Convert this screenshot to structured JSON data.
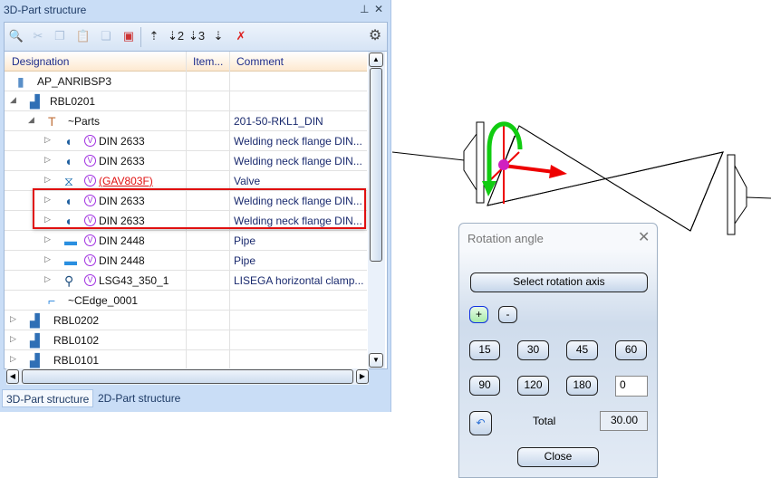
{
  "panel": {
    "title": "3D-Part structure",
    "pin_icon": "pin-icon",
    "close_icon": "close-icon",
    "columns": [
      "Designation",
      "Item...",
      "Comment"
    ],
    "rows": [
      {
        "level": 0,
        "expander": "",
        "icon": "project-icon",
        "variant": false,
        "name": "AP_ANRIBSP3",
        "comment": ""
      },
      {
        "level": 1,
        "expander": "expanded",
        "icon": "plant-icon",
        "variant": false,
        "name": "RBL0201",
        "comment": ""
      },
      {
        "level": 2,
        "expander": "expanded",
        "icon": "parts-icon",
        "variant": false,
        "name": "~Parts",
        "comment": "201-50-RKL1_DIN"
      },
      {
        "level": 3,
        "expander": "collapsed",
        "icon": "flange-icon",
        "variant": true,
        "name": "DIN 2633",
        "comment": "Welding neck flange DIN..."
      },
      {
        "level": 3,
        "expander": "collapsed",
        "icon": "flange-icon",
        "variant": true,
        "name": "DIN 2633",
        "comment": "Welding neck flange DIN..."
      },
      {
        "level": 3,
        "expander": "collapsed",
        "icon": "valve-icon",
        "variant": true,
        "name": "(GAV803F)",
        "comment": "Valve",
        "error": true
      },
      {
        "level": 3,
        "expander": "collapsed",
        "icon": "flange-icon",
        "variant": true,
        "name": "DIN 2633",
        "comment": "Welding neck flange DIN..."
      },
      {
        "level": 3,
        "expander": "collapsed",
        "icon": "flange-icon",
        "variant": true,
        "name": "DIN 2633",
        "comment": "Welding neck flange DIN..."
      },
      {
        "level": 3,
        "expander": "collapsed",
        "icon": "pipe-icon",
        "variant": true,
        "name": "DIN 2448",
        "comment": "Pipe"
      },
      {
        "level": 3,
        "expander": "collapsed",
        "icon": "pipe-icon",
        "variant": true,
        "name": "DIN 2448",
        "comment": "Pipe"
      },
      {
        "level": 3,
        "expander": "collapsed",
        "icon": "clamp-icon",
        "variant": true,
        "name": "LSG43_350_1",
        "comment": "LISEGA horizontal clamp..."
      },
      {
        "level": 2,
        "expander": "",
        "icon": "edge-icon",
        "variant": false,
        "name": "~CEdge_0001",
        "comment": ""
      },
      {
        "level": 0,
        "expander": "collapsed",
        "icon": "plant-icon",
        "variant": false,
        "name": "RBL0202",
        "comment": ""
      },
      {
        "level": 0,
        "expander": "collapsed",
        "icon": "plant-icon",
        "variant": false,
        "name": "RBL0102",
        "comment": ""
      },
      {
        "level": 0,
        "expander": "collapsed",
        "icon": "plant-icon",
        "variant": false,
        "name": "RBL0101",
        "comment": ""
      }
    ],
    "tabs": [
      "3D-Part structure",
      "2D-Part structure"
    ],
    "variant_badge": "V"
  },
  "dialog": {
    "title": "Rotation angle",
    "select_axis": "Select rotation axis",
    "plus": "+",
    "minus": "-",
    "angles": [
      "15",
      "30",
      "45",
      "60",
      "90",
      "120",
      "180"
    ],
    "custom_angle": "0",
    "total_label": "Total",
    "total_value": "30.00",
    "close": "Close"
  },
  "colors": {
    "error": "#e01010",
    "variant": "#a030e0",
    "highlight": "#e01010"
  }
}
